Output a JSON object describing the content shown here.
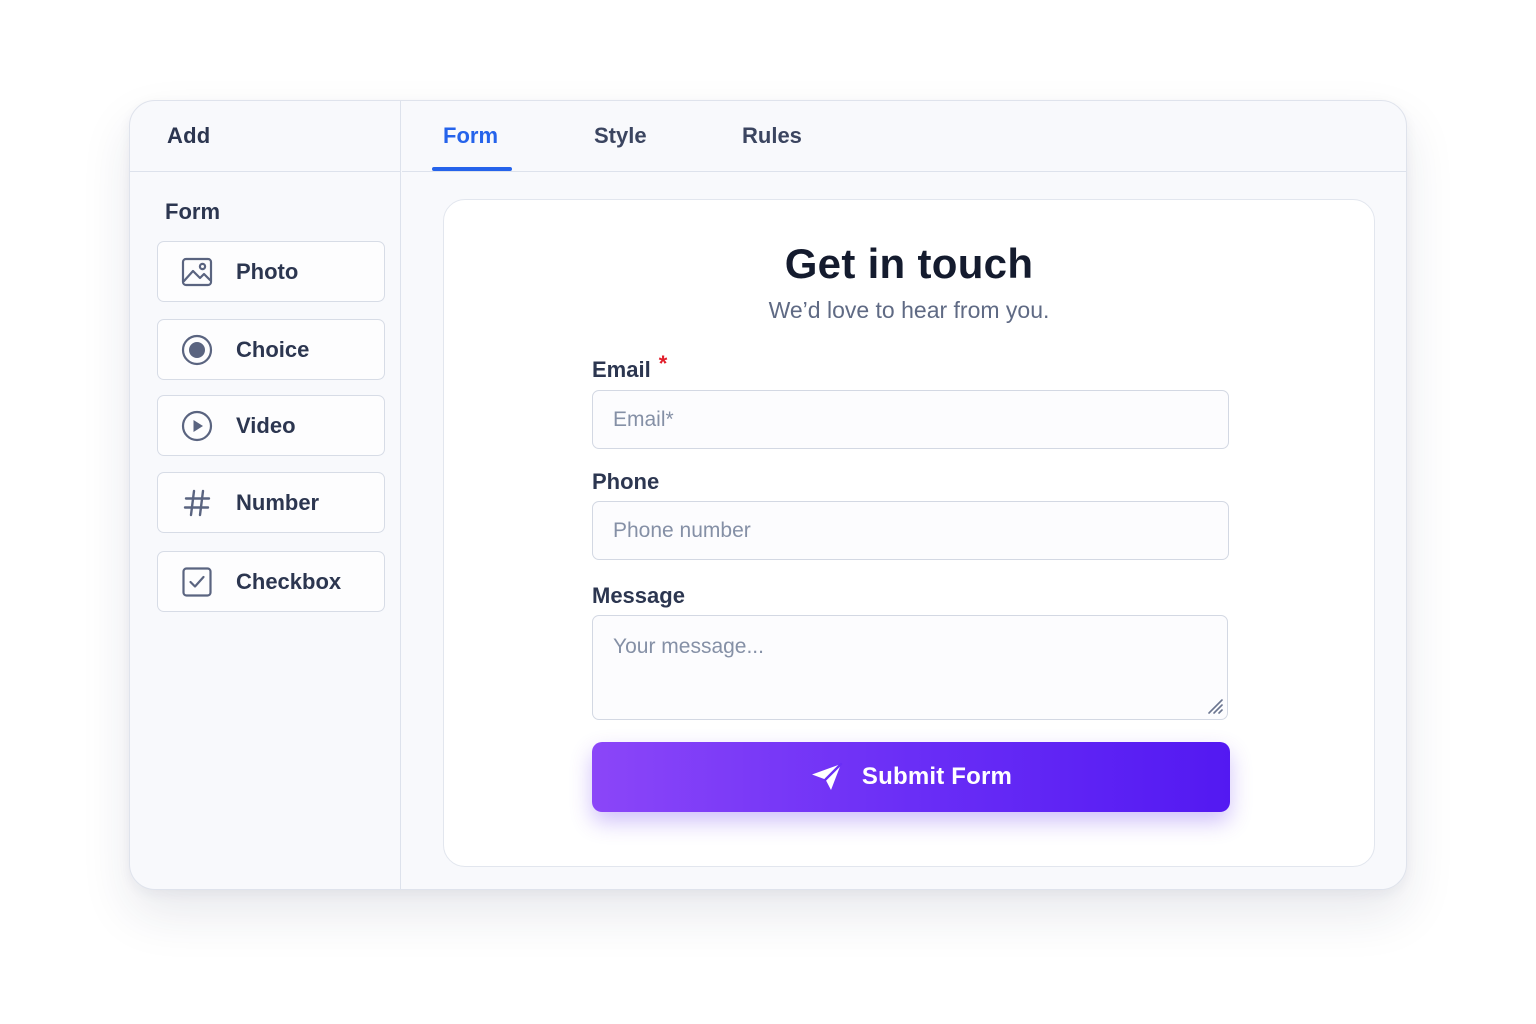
{
  "sidebar": {
    "title": "Add",
    "section_title": "Form",
    "items": [
      {
        "label": "Photo",
        "icon": "photo-icon"
      },
      {
        "label": "Choice",
        "icon": "radio-icon"
      },
      {
        "label": "Video",
        "icon": "play-icon"
      },
      {
        "label": "Number",
        "icon": "hash-icon"
      },
      {
        "label": "Checkbox",
        "icon": "checkbox-icon"
      }
    ]
  },
  "tabs": [
    {
      "label": "Form",
      "active": true
    },
    {
      "label": "Style",
      "active": false
    },
    {
      "label": "Rules",
      "active": false
    }
  ],
  "form": {
    "title": "Get in touch",
    "subtitle": "We’d love to hear from you.",
    "fields": {
      "email": {
        "label": "Email",
        "required_mark": "*",
        "placeholder": "Email*",
        "value": ""
      },
      "phone": {
        "label": "Phone",
        "placeholder": "Phone number",
        "value": ""
      },
      "message": {
        "label": "Message",
        "placeholder": "Your message...",
        "value": ""
      }
    },
    "submit": {
      "label": "Submit Form",
      "icon": "send-icon"
    }
  },
  "colors": {
    "accent": "#2563eb",
    "required": "#e11d2a",
    "submit_gradient_start": "#8b46f8",
    "submit_gradient_end": "#5319f2"
  }
}
